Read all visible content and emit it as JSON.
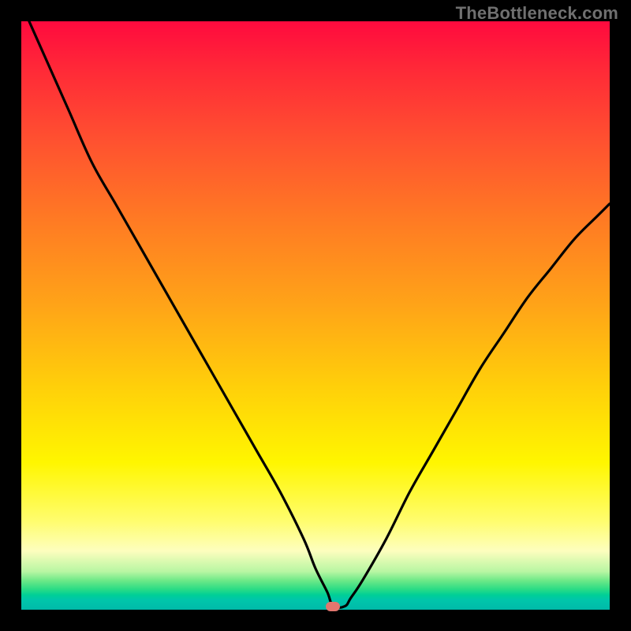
{
  "watermark": "TheBottleneck.com",
  "colors": {
    "frame": "#000000",
    "curve": "#000000",
    "marker": "#e2766e"
  },
  "chart_data": {
    "type": "line",
    "title": "",
    "xlabel": "",
    "ylabel": "",
    "xlim": [
      0,
      100
    ],
    "ylim": [
      0,
      100
    ],
    "note": "x,y in percent of plot area; y measured from top (0=top, 100=bottom). Curve depicts a bottleneck V-shape with minimum near x≈53.",
    "series": [
      {
        "name": "bottleneck-curve",
        "x": [
          0,
          4,
          8,
          12,
          16,
          20,
          24,
          28,
          32,
          36,
          40,
          44,
          48,
          50,
          52,
          53,
          55,
          56,
          58,
          62,
          66,
          70,
          74,
          78,
          82,
          86,
          90,
          94,
          98,
          100
        ],
        "y": [
          -3,
          6,
          15,
          24,
          31,
          38,
          45,
          52,
          59,
          66,
          73,
          80,
          88,
          93,
          97,
          99.4,
          99.4,
          98,
          95,
          88,
          80,
          73,
          66,
          59,
          53,
          47,
          42,
          37,
          33,
          31
        ]
      }
    ],
    "min_marker": {
      "x": 53,
      "y": 99.4
    },
    "background_gradient": {
      "orientation": "vertical",
      "stops": [
        {
          "pos": 0.0,
          "color": "#ff0a3e"
        },
        {
          "pos": 0.2,
          "color": "#ff5030"
        },
        {
          "pos": 0.48,
          "color": "#ffa318"
        },
        {
          "pos": 0.75,
          "color": "#fff600"
        },
        {
          "pos": 0.9,
          "color": "#fdfebe"
        },
        {
          "pos": 0.96,
          "color": "#2cdc85"
        },
        {
          "pos": 1.0,
          "color": "#00baa9"
        }
      ]
    }
  }
}
